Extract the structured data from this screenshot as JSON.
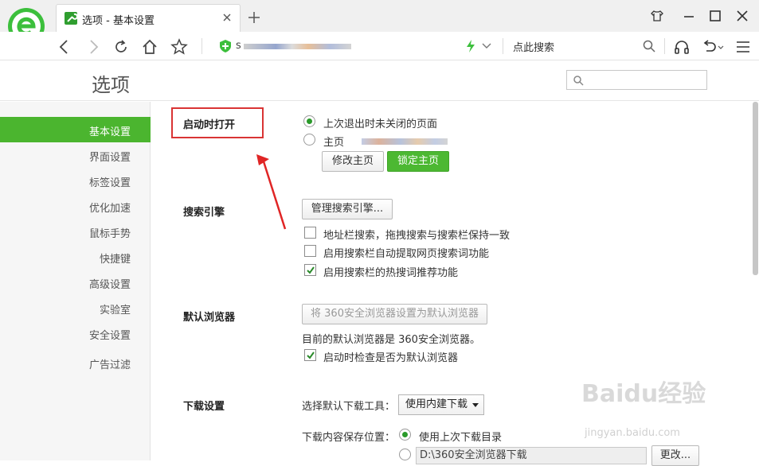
{
  "browser": {
    "tab_title": "选项 - 基本设置",
    "address_prefix": "s",
    "search_placeholder": "点此搜索"
  },
  "options": {
    "title": "选项",
    "search_value": ""
  },
  "sidebar": {
    "items": [
      {
        "label": "基本设置"
      },
      {
        "label": "界面设置"
      },
      {
        "label": "标签设置"
      },
      {
        "label": "优化加速"
      },
      {
        "label": "鼠标手势"
      },
      {
        "label": "快捷键"
      },
      {
        "label": "高级设置"
      },
      {
        "label": "实验室"
      },
      {
        "label": "安全设置"
      },
      {
        "label": "广告过滤"
      }
    ]
  },
  "startup": {
    "label": "启动时打开",
    "opt_last": "上次退出时未关闭的页面",
    "opt_home": "主页",
    "selected": "last",
    "btn_edit_home": "修改主页",
    "btn_lock_home": "锁定主页"
  },
  "search_engine": {
    "label": "搜索引擎",
    "btn_manage": "管理搜索引擎...",
    "checks": [
      {
        "label": "地址栏搜索，拖拽搜索与搜索栏保持一致",
        "checked": false
      },
      {
        "label": "启用搜索栏自动提取网页搜索词功能",
        "checked": false
      },
      {
        "label": "启用搜索栏的热搜词推荐功能",
        "checked": true
      }
    ]
  },
  "default_browser": {
    "label": "默认浏览器",
    "btn_set_default": "将 360安全浏览器设置为默认浏览器",
    "status": "目前的默认浏览器是 360安全浏览器。",
    "check_on_startup": "启动时检查是否为默认浏览器",
    "check_on_startup_checked": true
  },
  "download": {
    "label": "下载设置",
    "tool_label": "选择默认下载工具：",
    "tool_value": "使用内建下载",
    "location_label": "下载内容保存位置：",
    "opt_last_dir": "使用上次下载目录",
    "path_value": "D:\\360安全浏览器下载",
    "btn_change": "更改..."
  },
  "watermark": {
    "text": "Baidu经验",
    "sub": "jingyan.baidu.com"
  },
  "colors": {
    "accent_green": "#4bb52f",
    "highlight_red": "#d93434"
  }
}
